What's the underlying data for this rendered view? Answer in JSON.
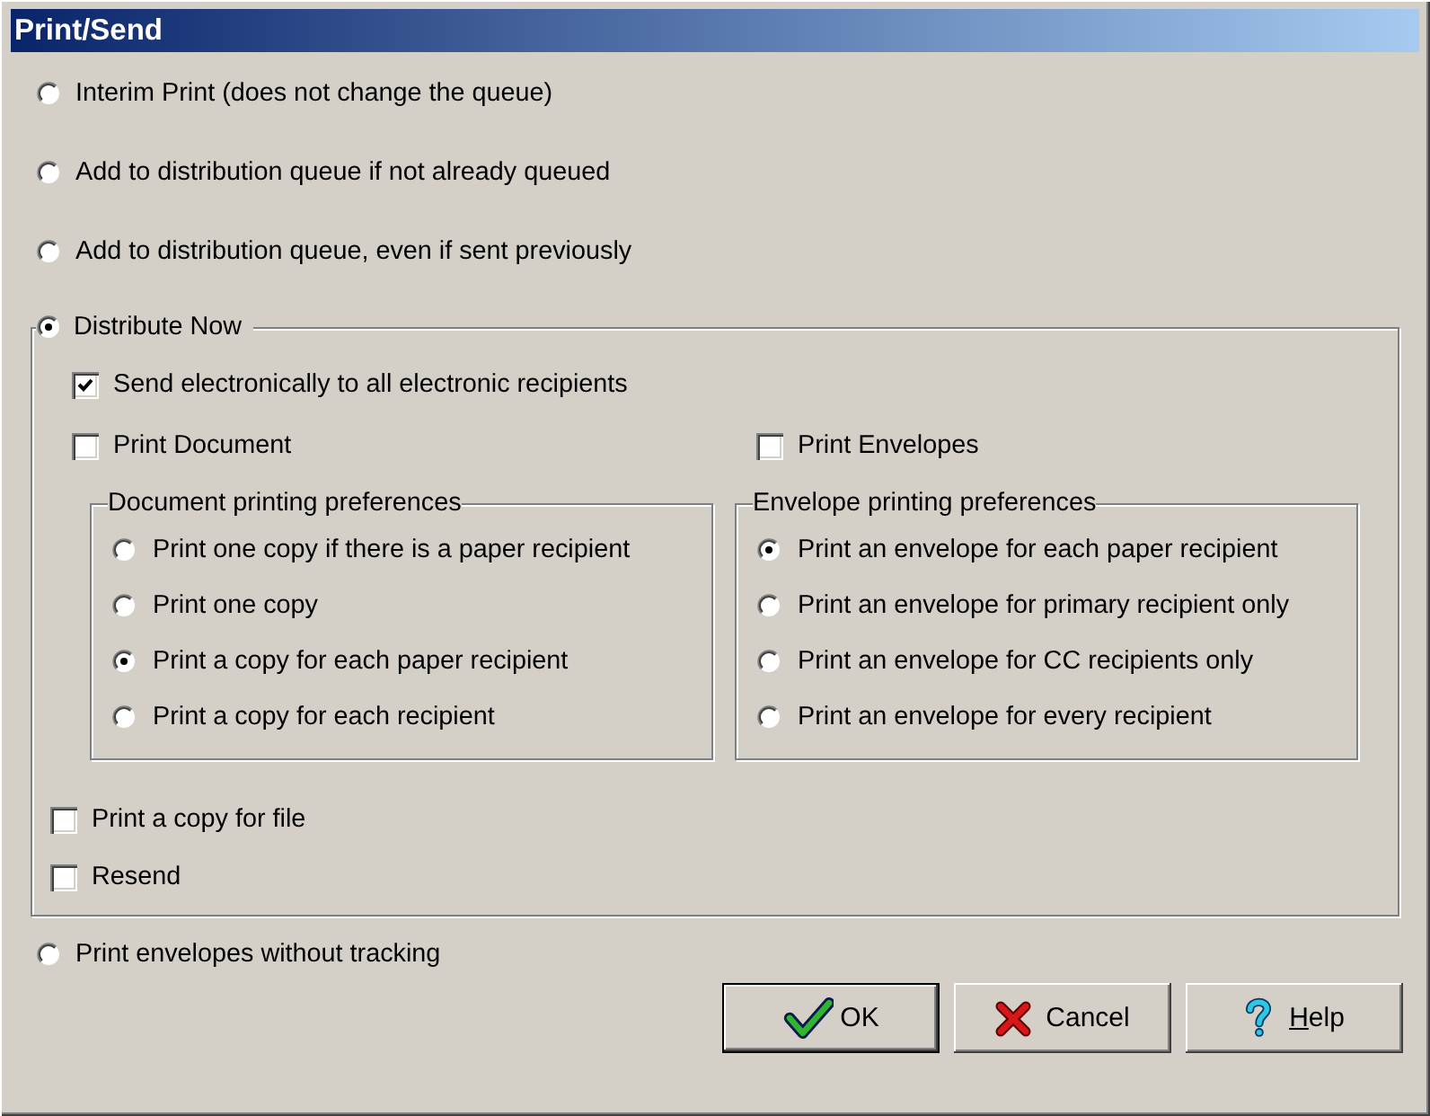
{
  "window": {
    "title": "Print/Send"
  },
  "options": [
    {
      "kind": "radio",
      "label": "Interim Print (does not change the queue)",
      "selected": false
    },
    {
      "kind": "radio",
      "label": "Add to distribution queue if not already queued",
      "selected": false
    },
    {
      "kind": "radio",
      "label": "Add to distribution queue, even if sent previously",
      "selected": false
    },
    {
      "kind": "group",
      "label": "Distribute Now",
      "selected": true,
      "send_electronically": {
        "label": "Send electronically to all electronic recipients",
        "checked": true
      },
      "print_document": {
        "label": "Print Document",
        "checked": false
      },
      "print_envelopes": {
        "label": "Print Envelopes",
        "checked": false
      },
      "preference_groups": [
        {
          "title": "Document printing preferences",
          "options": [
            {
              "label": "Print one copy if there is a paper recipient",
              "selected": false
            },
            {
              "label": "Print one copy",
              "selected": false
            },
            {
              "label": "Print a copy for each paper recipient",
              "selected": true
            },
            {
              "label": "Print a copy for each recipient",
              "selected": false
            }
          ]
        },
        {
          "title": "Envelope printing preferences",
          "options": [
            {
              "label": "Print an envelope for each paper recipient",
              "selected": true
            },
            {
              "label": "Print an envelope for primary recipient only",
              "selected": false
            },
            {
              "label": "Print an envelope for CC recipients only",
              "selected": false
            },
            {
              "label": "Print an envelope for every recipient",
              "selected": false
            }
          ]
        }
      ],
      "extra_options": [
        {
          "label": "Print a copy for file",
          "checked": false
        },
        {
          "label": "Resend",
          "checked": false
        }
      ]
    },
    {
      "kind": "radio",
      "label": "Print envelopes without tracking",
      "selected": false
    }
  ],
  "buttons": [
    {
      "kind": "ok",
      "label": "OK",
      "default": true,
      "access_key_underlined": false
    },
    {
      "kind": "cancel",
      "label": "Cancel",
      "default": false,
      "access_key_underlined": false
    },
    {
      "kind": "help",
      "label": "Help",
      "default": false,
      "access_key_underlined": true
    }
  ]
}
